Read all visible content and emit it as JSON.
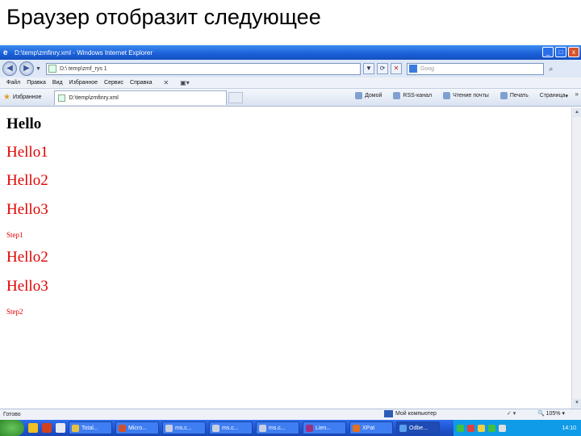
{
  "slide": {
    "title": "Браузер отобразит следующее"
  },
  "window": {
    "title": "D:\\temp\\zmfinry.xml - Windows Internet Explorer",
    "controls": [
      "_",
      "□",
      "x"
    ]
  },
  "navbar": {
    "address": "D:\\ temp\\zmf_rys 1",
    "search_placeholder": "Goog"
  },
  "menubar": {
    "items": [
      "Файл",
      "Правка",
      "Вид",
      "Избранное",
      "Сервис",
      "Справка"
    ]
  },
  "favbar": {
    "favorites_label": "Избранное",
    "tab_title": "D:\\temp\\zmfinry.xml",
    "commands": [
      "Домой",
      "RSS-канал",
      "Чтение почты",
      "Печать",
      "Страница"
    ],
    "more": "»"
  },
  "content": {
    "lines": [
      {
        "text": "Hello",
        "style": "big black"
      },
      {
        "text": "Hello1",
        "style": "big red"
      },
      {
        "text": "Hello2",
        "style": "big red"
      },
      {
        "text": "Hello3",
        "style": "big red"
      },
      {
        "text": "Step1",
        "style": "small red"
      },
      {
        "text": "Hello2",
        "style": "big red"
      },
      {
        "text": "Hello3",
        "style": "big red"
      },
      {
        "text": "Step2",
        "style": "small red"
      }
    ]
  },
  "statusbar": {
    "text": "Готово",
    "zone": "Мой компьютер",
    "zoom": "105%"
  },
  "taskbar": {
    "tasks": [
      "Total...",
      "Micro...",
      "ms.c...",
      "ms.c...",
      "ms.c...",
      "Lien...",
      "XPat",
      "Odbe..."
    ],
    "clock": "14:10"
  },
  "colors": {
    "red_text": "#e00000",
    "titlebar_blue": "#1a5fd8",
    "taskbar_blue": "#1f55d0"
  }
}
